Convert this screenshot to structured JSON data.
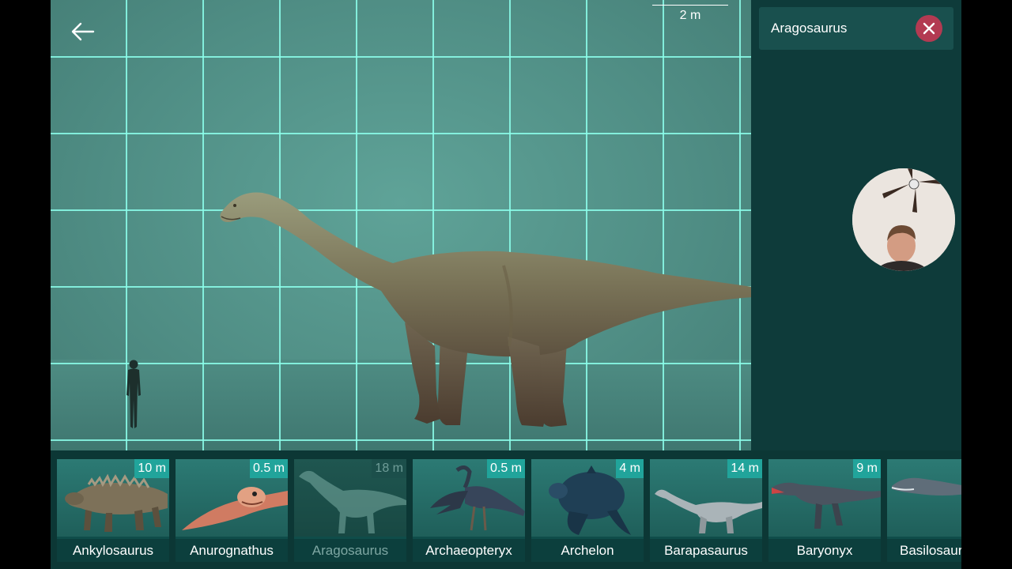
{
  "viewport": {
    "scale_label": "2 m"
  },
  "search": {
    "value": "Aragosaurus"
  },
  "carousel": {
    "items": [
      {
        "name": "Ankylosaurus",
        "size": "10 m",
        "selected": false
      },
      {
        "name": "Anurognathus",
        "size": "0.5 m",
        "selected": false
      },
      {
        "name": "Aragosaurus",
        "size": "18 m",
        "selected": true
      },
      {
        "name": "Archaeopteryx",
        "size": "0.5 m",
        "selected": false
      },
      {
        "name": "Archelon",
        "size": "4 m",
        "selected": false
      },
      {
        "name": "Barapasaurus",
        "size": "14 m",
        "selected": false
      },
      {
        "name": "Baryonyx",
        "size": "9 m",
        "selected": false
      },
      {
        "name": "Basilosaurus",
        "size": "",
        "selected": false
      }
    ]
  },
  "colors": {
    "grid": "#8cffeb",
    "panel": "#0e3b3a",
    "badge": "#21a49b",
    "clear_button": "#b33a52"
  },
  "icons": {
    "back": "arrow-left-icon",
    "clear": "close-icon"
  }
}
